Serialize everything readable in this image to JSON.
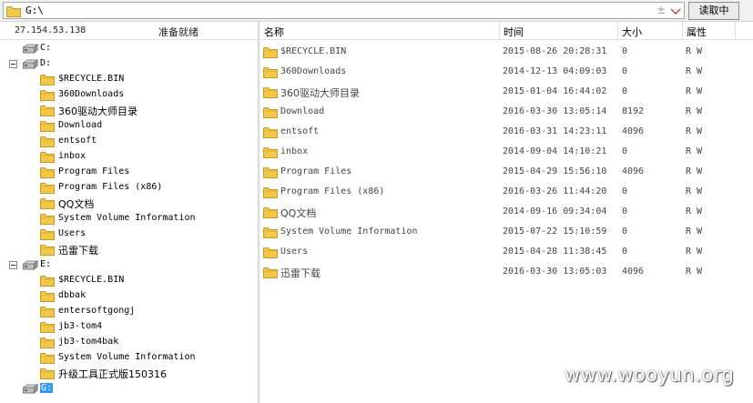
{
  "path_bar": {
    "path": "G:\\",
    "up_glyph": "±",
    "read_button": "读取中"
  },
  "left_panel": {
    "ip": "27.154.53.138",
    "status": "准备就绪",
    "drives": [
      {
        "name": "C:",
        "expanded": false,
        "folders": []
      },
      {
        "name": "D:",
        "expanded": true,
        "folders": [
          "$RECYCLE.BIN",
          "360Downloads",
          "360驱动大师目录",
          "Download",
          "entsoft",
          "inbox",
          "Program Files",
          "Program Files (x86)",
          "QQ文档",
          "System Volume Information",
          "Users",
          "迅雷下载"
        ]
      },
      {
        "name": "E:",
        "expanded": true,
        "folders": [
          "$RECYCLE.BIN",
          "dbbak",
          "entersoftgongj",
          "jb3-tom4",
          "jb3-tom4bak",
          "System Volume Information",
          "升级工具正式版150316"
        ]
      },
      {
        "name": "G:",
        "expanded": false,
        "selected": true,
        "folders": []
      }
    ]
  },
  "list": {
    "columns": [
      "名称",
      "时间",
      "大小",
      "属性"
    ],
    "rows": [
      {
        "name": "$RECYCLE.BIN",
        "time": "2015-08-26 20:28:31",
        "size": "0",
        "attr": "R W"
      },
      {
        "name": "360Downloads",
        "time": "2014-12-13 04:09:03",
        "size": "0",
        "attr": "R W"
      },
      {
        "name": "360驱动大师目录",
        "time": "2015-01-04 16:44:02",
        "size": "0",
        "attr": "R W"
      },
      {
        "name": "Download",
        "time": "2016-03-30 13:05:14",
        "size": "8192",
        "attr": "R W"
      },
      {
        "name": "entsoft",
        "time": "2016-03-31 14:23:11",
        "size": "4096",
        "attr": "R W"
      },
      {
        "name": "inbox",
        "time": "2014-09-04 14:10:21",
        "size": "0",
        "attr": "R W"
      },
      {
        "name": "Program Files",
        "time": "2015-04-29 15:56:10",
        "size": "4096",
        "attr": "R W"
      },
      {
        "name": "Program Files (x86)",
        "time": "2016-03-26 11:44:20",
        "size": "0",
        "attr": "R W"
      },
      {
        "name": "QQ文档",
        "time": "2014-09-16 09:34:04",
        "size": "0",
        "attr": "R W"
      },
      {
        "name": "System Volume Information",
        "time": "2015-07-22 15:10:59",
        "size": "0",
        "attr": "R W"
      },
      {
        "name": "Users",
        "time": "2015-04-28 11:38:45",
        "size": "0",
        "attr": "R W"
      },
      {
        "name": "迅雷下载",
        "time": "2016-03-30 13:05:03",
        "size": "4096",
        "attr": "R W"
      }
    ]
  },
  "watermark": "www.wooyun.org",
  "colors": {
    "folder": "#f2c84b",
    "folder_dark": "#c99a1e",
    "selection": "#3399ff"
  },
  "icons": {
    "folder": "folder-icon",
    "drive": "drive-icon",
    "expander": "collapse-box-icon",
    "dropdown": "chevron-down-icon"
  }
}
